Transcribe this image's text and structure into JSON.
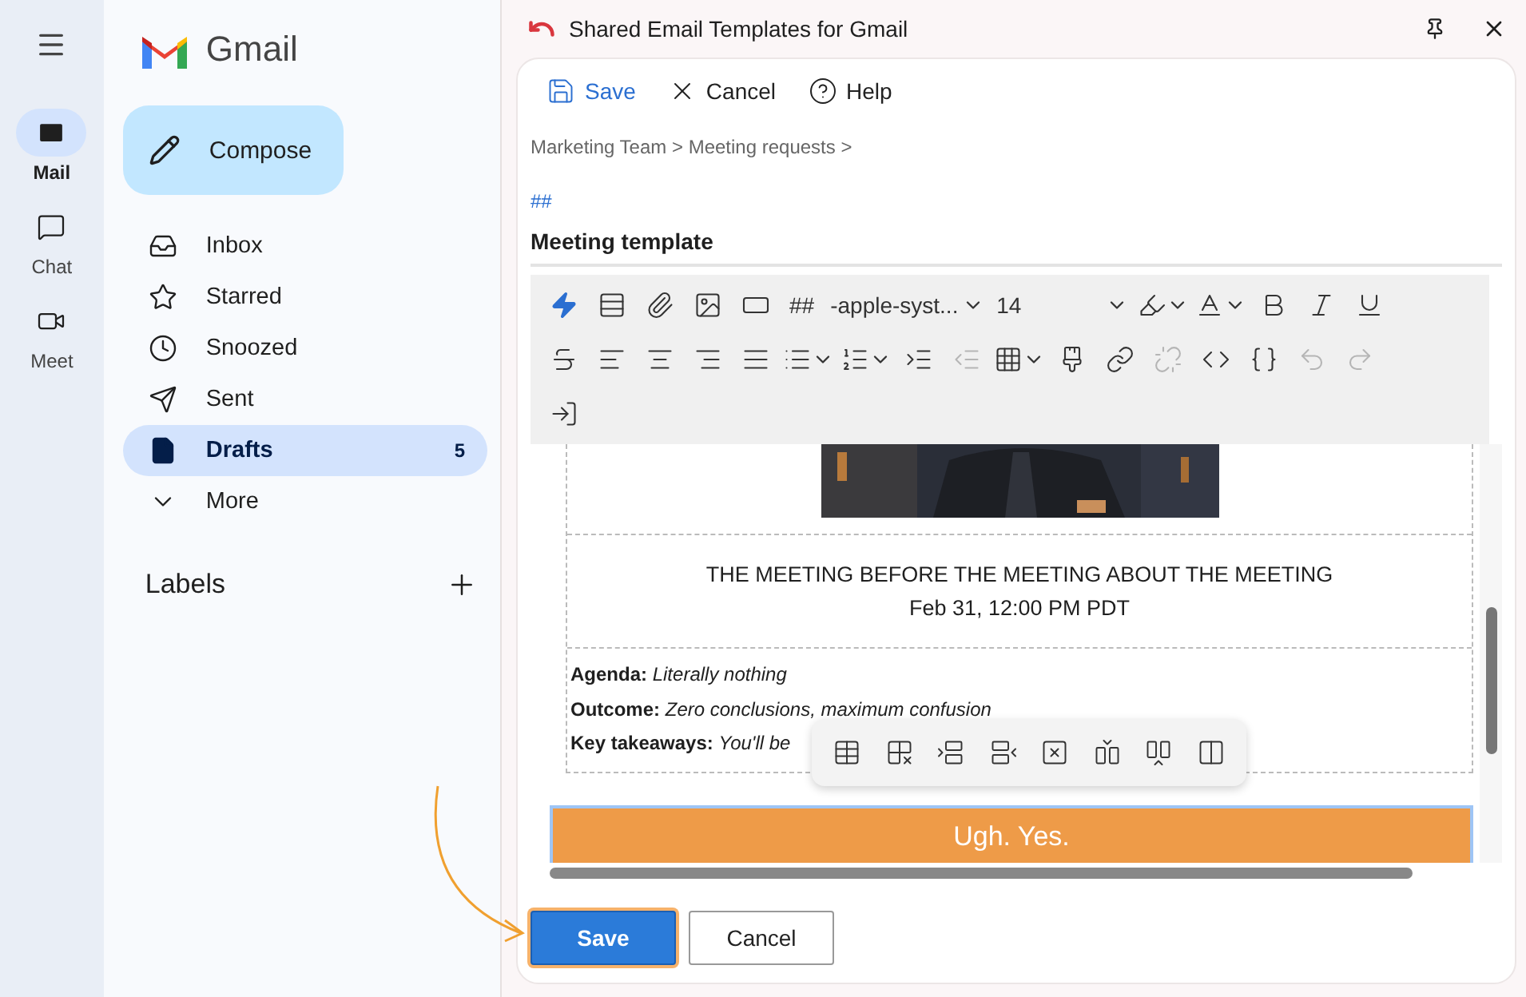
{
  "rail": {
    "items": [
      {
        "label": "Mail",
        "selected": true
      },
      {
        "label": "Chat",
        "selected": false
      },
      {
        "label": "Meet",
        "selected": false
      }
    ]
  },
  "nav": {
    "logo": "Gmail",
    "compose": "Compose",
    "items": [
      {
        "label": "Inbox",
        "selected": false
      },
      {
        "label": "Starred",
        "selected": false
      },
      {
        "label": "Snoozed",
        "selected": false
      },
      {
        "label": "Sent",
        "selected": false
      },
      {
        "label": "Drafts",
        "count": "5",
        "selected": true
      },
      {
        "label": "More",
        "selected": false
      }
    ],
    "labels_heading": "Labels"
  },
  "dialog": {
    "title": "Shared Email Templates for Gmail",
    "actions": [
      "Save",
      "Cancel",
      "Help"
    ],
    "breadcrumb": "Marketing Team > Meeting requests >",
    "hashtag": "##",
    "template_name": "Meeting template",
    "toolbar": {
      "hashtags": "##",
      "font": "-apple-syst...",
      "size": "14",
      "buttons": [
        {
          "disabled": false
        },
        {
          "disabled": false
        },
        {
          "disabled": false
        },
        {
          "disabled": false
        },
        {
          "disabled": false
        },
        {
          "disabled": false
        },
        {
          "disabled": false
        },
        {
          "disabled": false
        },
        {
          "disabled": false
        },
        {
          "disabled": false
        },
        {
          "disabled": false
        },
        {
          "disabled": false
        },
        {
          "disabled": false
        },
        {
          "disabled": false
        },
        {
          "disabled": false
        },
        {
          "disabled": false
        },
        {
          "disabled": false
        },
        {
          "disabled": false
        },
        {
          "disabled": true
        },
        {
          "disabled": false
        },
        {
          "disabled": false
        },
        {
          "disabled": false
        },
        {
          "disabled": true
        },
        {
          "disabled": true
        },
        {
          "disabled": true
        },
        {
          "disabled": false
        }
      ]
    },
    "body": {
      "headline": "THE MEETING BEFORE THE MEETING ABOUT THE MEETING",
      "date": "Feb 31, 12:00 PM PDT",
      "fields": [
        {
          "label": "Agenda:",
          "value": "Literally nothing"
        },
        {
          "label": "Outcome:",
          "value": "Zero conclusions, maximum confusion"
        },
        {
          "label": "Key takeaways:",
          "value": "You'll be"
        }
      ],
      "cta": "Ugh. Yes."
    },
    "footer": [
      "Save",
      "Cancel"
    ]
  }
}
